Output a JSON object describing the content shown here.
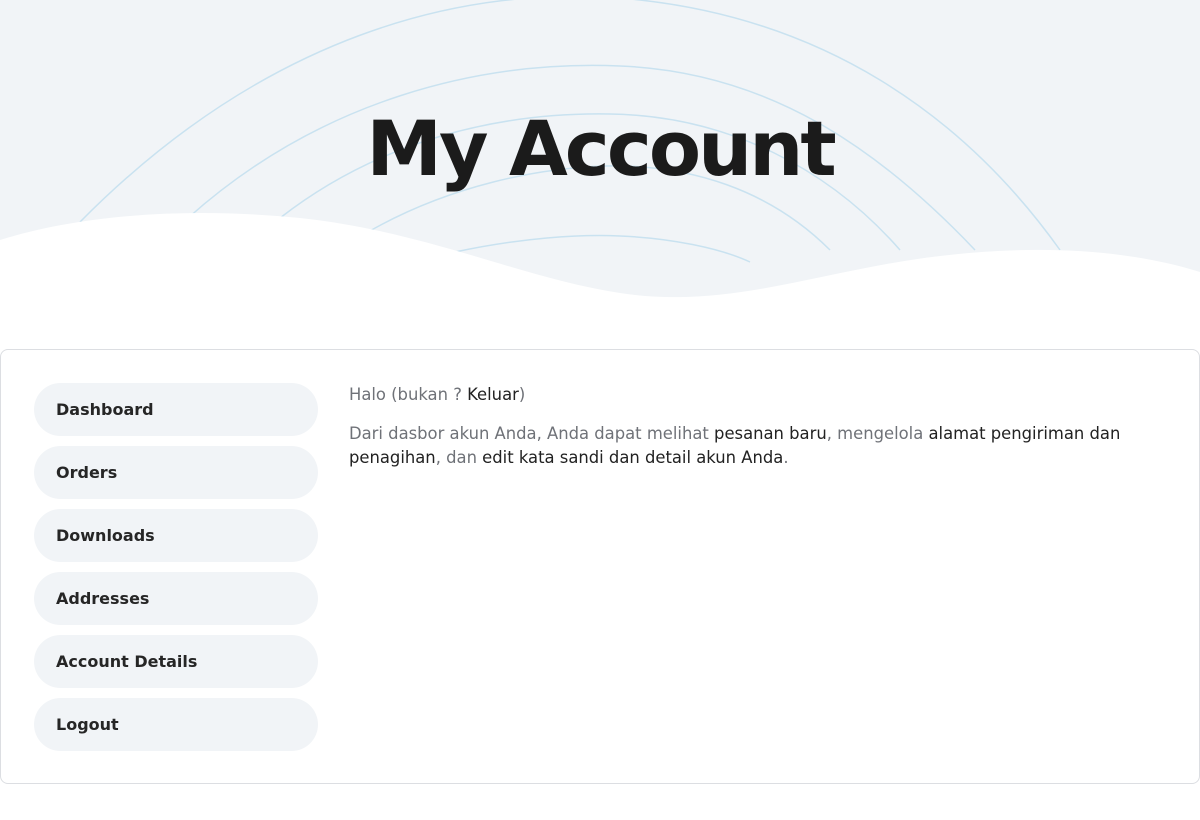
{
  "hero": {
    "title": "My Account"
  },
  "nav": {
    "items": [
      {
        "label": "Dashboard"
      },
      {
        "label": "Orders"
      },
      {
        "label": "Downloads"
      },
      {
        "label": "Addresses"
      },
      {
        "label": "Account Details"
      },
      {
        "label": "Logout"
      }
    ]
  },
  "dashboard": {
    "greeting": {
      "prefix": "Halo (bukan ? ",
      "logout_link": "Keluar",
      "suffix": ")"
    },
    "intro": {
      "part1": "Dari dasbor akun Anda, Anda dapat melihat ",
      "link_orders": "pesanan baru",
      "part2": ", mengelola ",
      "link_addresses": "alamat pengiriman dan penagihan",
      "part3": ", dan ",
      "link_account": "edit kata sandi dan detail akun Anda",
      "part4": "."
    }
  },
  "colors": {
    "hero_background": "#f1f4f7",
    "hero_lines": "#c9e2f0",
    "nav_background": "#f1f4f7",
    "text_dark": "#222222",
    "text_muted": "#6f7278"
  }
}
